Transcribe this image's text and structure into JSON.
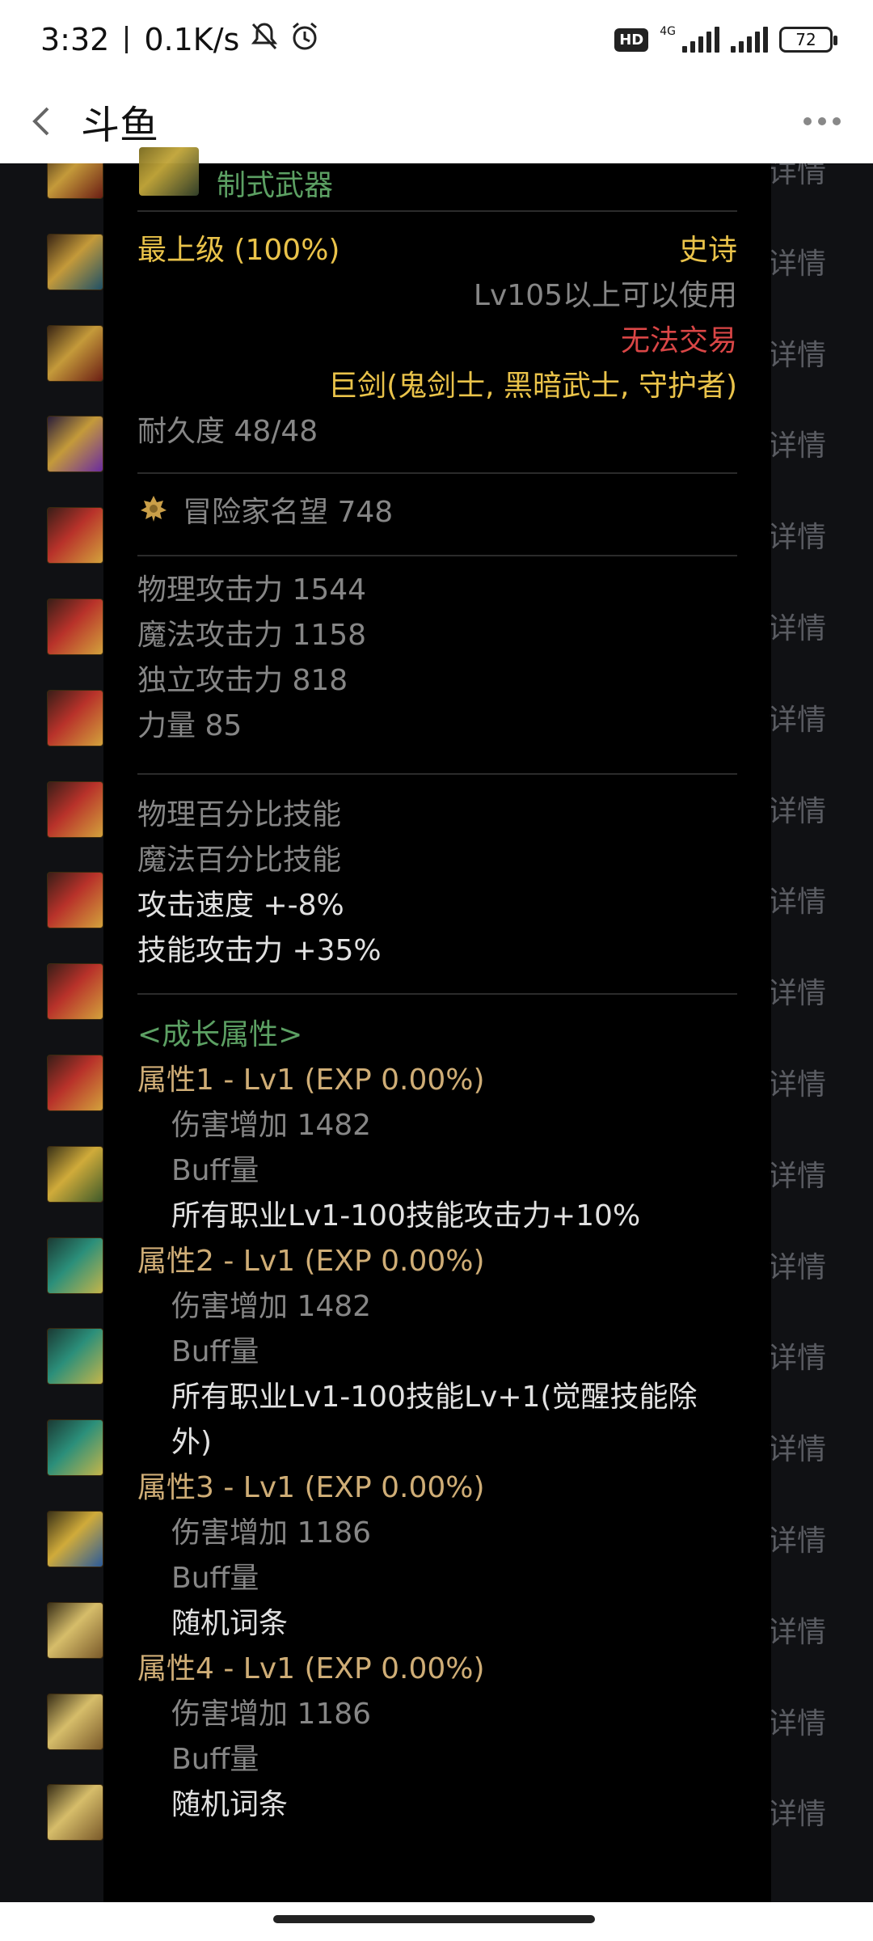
{
  "status_bar": {
    "time": "3:32",
    "speed": "0.1K/s",
    "hd": "HD",
    "network": "4G",
    "battery": "72"
  },
  "app_bar": {
    "title": "斗鱼",
    "back_icon": "back-arrow-icon",
    "more_icon": "more-dots-icon"
  },
  "background_list": {
    "detail_label": "详情"
  },
  "item": {
    "type_label": "制式武器",
    "grade": "最上级 (100%)",
    "rarity": "史诗",
    "level_req": "Lv105以上可以使用",
    "trade": "无法交易",
    "class": "巨剑(鬼剑士, 黑暗武士, 守护者)",
    "durability": "耐久度 48/48",
    "reputation": "冒险家名望 748",
    "stats": [
      {
        "label": "物理攻击力",
        "value": "1544"
      },
      {
        "label": "魔法攻击力",
        "value": "1158"
      },
      {
        "label": "独立攻击力",
        "value": "818"
      },
      {
        "label": "力量",
        "value": "85"
      }
    ],
    "percent_skill_1": "物理百分比技能",
    "percent_skill_2": "魔法百分比技能",
    "attack_speed": "攻击速度  +-8%",
    "skill_attack": "技能攻击力  +35%",
    "growth_header": "<成长属性>",
    "growth": [
      {
        "title": "属性1 - Lv1 (EXP 0.00%)",
        "damage": "伤害增加  1482",
        "buff": "Buff量",
        "effect": [
          "所有职业Lv1-100技能攻击力+10%"
        ]
      },
      {
        "title": "属性2 - Lv1 (EXP 0.00%)",
        "damage": "伤害增加  1482",
        "buff": "Buff量",
        "effect": [
          "所有职业Lv1-100技能Lv+1(觉醒技能除",
          "外)"
        ]
      },
      {
        "title": "属性3 - Lv1 (EXP 0.00%)",
        "damage": "伤害增加  1186",
        "buff": "Buff量",
        "effect": [
          "随机词条"
        ]
      },
      {
        "title": "属性4 - Lv1 (EXP 0.00%)",
        "damage": "伤害增加  1186",
        "buff": "Buff量",
        "effect": [
          "随机词条"
        ]
      }
    ]
  },
  "colors": {
    "green": "#5fa566",
    "gold": "#f2c94c",
    "tan": "#d6b37a",
    "grey": "#8a8a8a",
    "white": "#e8e8e8",
    "red": "#e04848"
  }
}
